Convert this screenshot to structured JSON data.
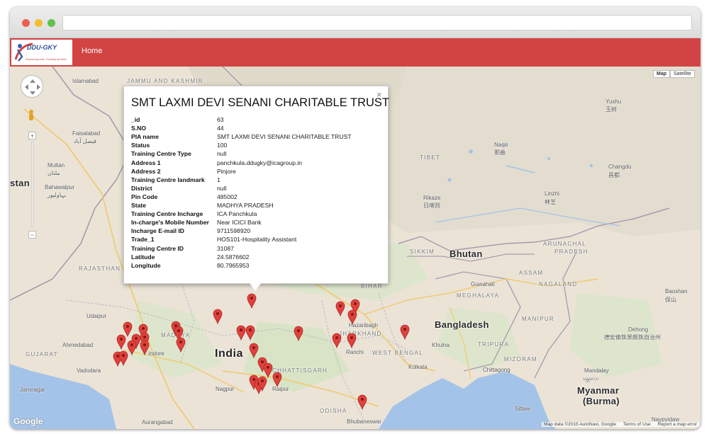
{
  "browser": {
    "colors": {
      "close": "#ec5e52",
      "minimize": "#f5bd2e",
      "maximize": "#5fc249"
    }
  },
  "header": {
    "logo_text": "DDU-GKY",
    "logo_tagline": "Empowering India - Powering the World",
    "nav_home": "Home",
    "nav_color": "#d24444"
  },
  "map": {
    "type_buttons": {
      "map": "Map",
      "satellite": "Satellite"
    },
    "zoom_in": "+",
    "zoom_out": "−",
    "google_logo": "Google",
    "footer": {
      "map_data": "Map data ©2015 AutoNavi, Google",
      "terms": "Terms of Use",
      "report": "Report a map error"
    },
    "labels": {
      "islamabad": "Islamabad",
      "jammu_kashmir": "JAMMU AND KASHMIR",
      "faisalabad": "Faisalabad",
      "faisalabad_ur": "فیصل آباد",
      "multan": "Multan",
      "multan_ur": "ملتان",
      "bahawalpur": "Bahawalpur",
      "bahawalpur_ur": "بہاولپور",
      "pakistan_partial": "stan",
      "rajasthan": "RAJASTHAN",
      "udaipur": "Udaipur",
      "gujarat": "GUJARAT",
      "ahmedabad": "Ahmedabad",
      "vadodara": "Vadodara",
      "jamnagar": "Jamnagar",
      "indore": "Indore",
      "madhya": "MADHYA",
      "india": "India",
      "chhattisgarh": "CHHATTISGARH",
      "nagpur": "Nagpur",
      "raipur": "Raipur",
      "aurangabad": "Aurangabad",
      "odisha": "ODISHA",
      "bhubaneswar": "Bhubaneswar",
      "jharkhand": "JHARKHAND",
      "hazaribagh": "Hazaribagh",
      "ranchi": "Ranchi",
      "west_bengal": "WEST BENGAL",
      "kolkata": "Kolkata",
      "bihar": "BIHAR",
      "bangladesh": "Bangladesh",
      "tripura": "TRIPURA",
      "khulna": "Khulna",
      "chittagong": "Chittagong",
      "bhutan": "Bhutan",
      "sikkim": "SIKKIM",
      "assam": "ASSAM",
      "meghalaya": "MEGHALAYA",
      "guwahati": "Guwahati",
      "nagaland": "NAGALAND",
      "manipur": "MANIPUR",
      "mizoram": "MIZORAM",
      "arunachal": "ARUNACHAL",
      "pradesh": "PRADESH",
      "tibet": "TIBET",
      "rikaze": "Rikaze",
      "rikaze_cn": "日喀则",
      "naqu": "Naqu",
      "naqu_cn": "那曲",
      "linzhi": "Linzhi",
      "linzhi_cn": "林芝",
      "yushu": "Yushu",
      "yushu_cn": "玉树",
      "changdu": "Changdu",
      "changdu_cn": "昌都",
      "baoshan": "Baoshan",
      "baoshan_cn": "保山",
      "dehong": "Dehong",
      "dehong_cn": "德宏傣族景颇族自治州",
      "mandalay": "Mandalay",
      "mandalay_my": "မန္တလေး",
      "myanmar": "Myanmar",
      "burma": "(Burma)",
      "sittwe": "Sittwe",
      "naypyidaw": "Naypyidaw"
    }
  },
  "popup": {
    "title": "SMT LAXMI DEVI SENANI CHARITABLE TRUST",
    "close": "×",
    "fields": [
      {
        "key": "_id",
        "value": "63"
      },
      {
        "key": "S.NO",
        "value": "44"
      },
      {
        "key": "PIA name",
        "value": "SMT LAXMI DEVI SENANI CHARITABLE TRUST"
      },
      {
        "key": "Status",
        "value": "100"
      },
      {
        "key": "Training Centre Type",
        "value": "null"
      },
      {
        "key": "Address 1",
        "value": "panchkula.ddugky@icagroup.in"
      },
      {
        "key": "Address 2",
        "value": "Pinjore"
      },
      {
        "key": "Training Centre landmark",
        "value": "1"
      },
      {
        "key": "District",
        "value": "null"
      },
      {
        "key": "Pin Code",
        "value": "485002"
      },
      {
        "key": "State",
        "value": "MADHYA PRADESH"
      },
      {
        "key": "Training Centre Incharge",
        "value": "ICA Panchkula"
      },
      {
        "key": "In-charge's Mobile Number",
        "value": "Near ICICI Bank"
      },
      {
        "key": "Incharge E-mail ID",
        "value": "9711598920"
      },
      {
        "key": "Trade_1",
        "value": "HOS101-Hospitality Assistant"
      },
      {
        "key": "Training Centre ID",
        "value": "31087"
      },
      {
        "key": "Latitude",
        "value": "24.5876602"
      },
      {
        "key": "Longitude",
        "value": "80.7965953"
      }
    ]
  }
}
